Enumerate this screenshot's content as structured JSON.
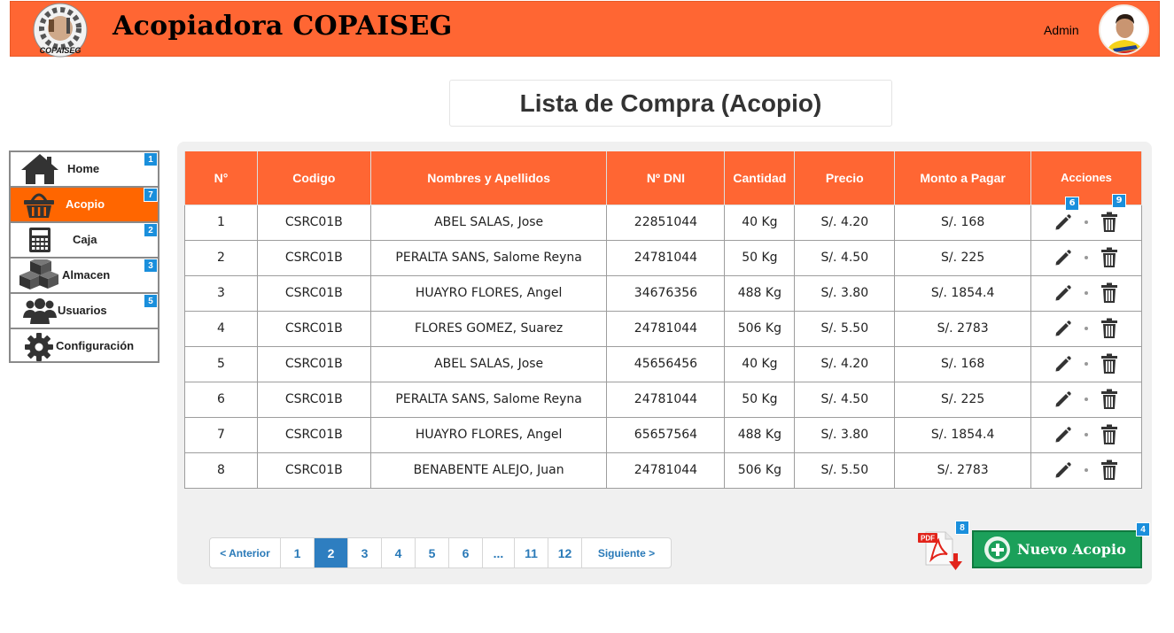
{
  "header": {
    "logo_text": "COPAISEG",
    "title": "Acopiadora COPAISEG",
    "user_label": "Admin"
  },
  "page": {
    "title": "Lista de Compra (Acopio)"
  },
  "sidebar": {
    "items": [
      {
        "label": "Home",
        "badge": "1",
        "icon": "home-icon",
        "active": false
      },
      {
        "label": "Acopio",
        "badge": "7",
        "icon": "basket-icon",
        "active": true
      },
      {
        "label": "Caja",
        "badge": "2",
        "icon": "calculator-icon",
        "active": false
      },
      {
        "label": "Almacen",
        "badge": "3",
        "icon": "boxes-icon",
        "active": false
      },
      {
        "label": "Usuarios",
        "badge": "5",
        "icon": "users-icon",
        "active": false
      },
      {
        "label": "Configuración",
        "badge": "",
        "icon": "gear-icon",
        "active": false
      }
    ]
  },
  "table": {
    "headers": [
      "N°",
      "Codigo",
      "Nombres y Apellidos",
      "Nº DNI",
      "Cantidad",
      "Precio",
      "Monto a Pagar",
      "Acciones"
    ],
    "rows": [
      {
        "n": "1",
        "codigo": "CSRC01B",
        "nombre": "ABEL SALAS, Jose",
        "dni": "22851044",
        "cantidad": "40 Kg",
        "precio": "S/.  4.20",
        "monto": "S/.  168"
      },
      {
        "n": "2",
        "codigo": "CSRC01B",
        "nombre": "PERALTA SANS, Salome Reyna",
        "dni": "24781044",
        "cantidad": "50 Kg",
        "precio": "S/.  4.50",
        "monto": "S/.  225"
      },
      {
        "n": "3",
        "codigo": "CSRC01B",
        "nombre": "HUAYRO FLORES, Angel",
        "dni": "34676356",
        "cantidad": "488 Kg",
        "precio": "S/.  3.80",
        "monto": "S/.  1854.4"
      },
      {
        "n": "4",
        "codigo": "CSRC01B",
        "nombre": "FLORES GOMEZ, Suarez",
        "dni": "24781044",
        "cantidad": "506 Kg",
        "precio": "S/.  5.50",
        "monto": "S/.  2783"
      },
      {
        "n": "5",
        "codigo": "CSRC01B",
        "nombre": "ABEL SALAS, Jose",
        "dni": "45656456",
        "cantidad": "40 Kg",
        "precio": "S/.  4.20",
        "monto": "S/.  168"
      },
      {
        "n": "6",
        "codigo": "CSRC01B",
        "nombre": "PERALTA SANS, Salome Reyna",
        "dni": "24781044",
        "cantidad": "50 Kg",
        "precio": "S/.  4.50",
        "monto": "S/.  225"
      },
      {
        "n": "7",
        "codigo": "CSRC01B",
        "nombre": "HUAYRO FLORES, Angel",
        "dni": "65657564",
        "cantidad": "488 Kg",
        "precio": "S/.  3.80",
        "monto": "S/.  1854.4"
      },
      {
        "n": "8",
        "codigo": "CSRC01B",
        "nombre": "BENABENTE ALEJO, Juan",
        "dni": "24781044",
        "cantidad": "506 Kg",
        "precio": "S/.  5.50",
        "monto": "S/.  2783"
      }
    ],
    "edit_badge": "6",
    "delete_badge": "9"
  },
  "pagination": {
    "prev": "< Anterior",
    "pages": [
      "1",
      "2",
      "3",
      "4",
      "5",
      "6",
      "...",
      "11",
      "12"
    ],
    "active": "2",
    "next": "Siguiente >"
  },
  "actions": {
    "pdf_label": "PDF",
    "pdf_badge": "8",
    "new_label": "Nuevo Acopio",
    "new_badge": "4"
  },
  "colors": {
    "header": "#ff6633",
    "active_sidebar": "#ff6600",
    "badge": "#1a8fdc",
    "new_button": "#1ba05a",
    "pager_active": "#2e7ec0"
  }
}
